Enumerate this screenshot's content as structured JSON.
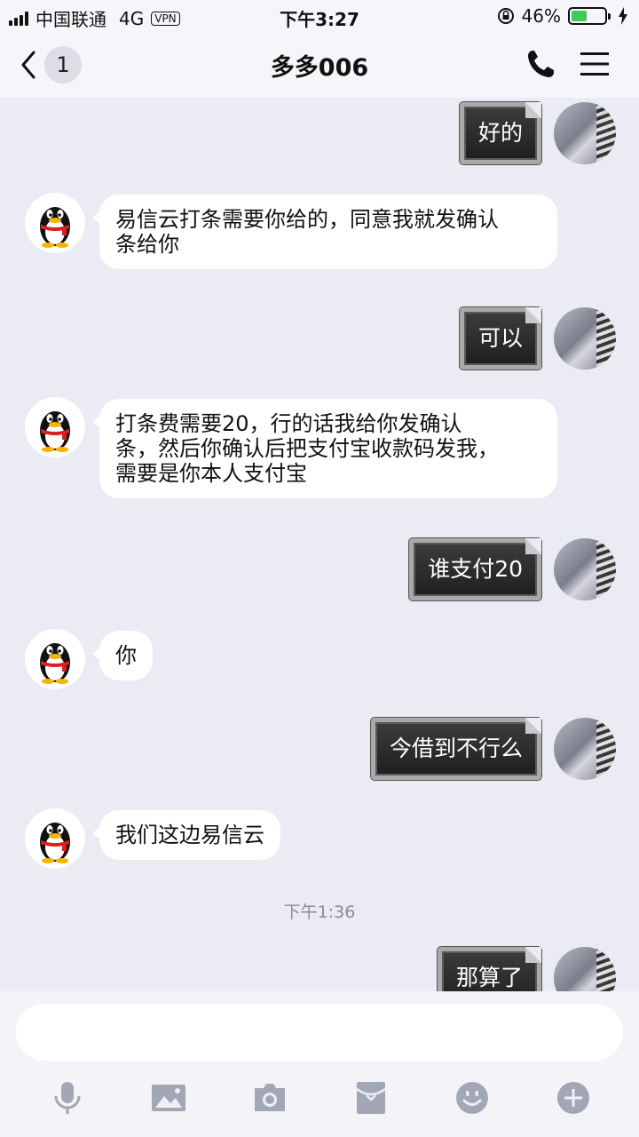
{
  "status_bar": {
    "carrier": "中国联通",
    "network": "4G",
    "vpn": "VPN",
    "time": "下午3:27",
    "battery_percent": "46%",
    "battery_level": 0.46,
    "battery_color": "#3ecb55"
  },
  "nav": {
    "unread_count": "1",
    "title": "多多006"
  },
  "messages": [
    {
      "from": "me",
      "text": "好的"
    },
    {
      "from": "them",
      "lines": [
        "易信云打条需要你给的，同意我就发确认",
        "条给你"
      ]
    },
    {
      "from": "me",
      "text": "可以"
    },
    {
      "from": "them",
      "lines": [
        "打条费需要20，行的话我给你发确认",
        "条，然后你确认后把支付宝收款码发我，",
        "需要是你本人支付宝"
      ]
    },
    {
      "from": "me",
      "text": "谁支付20"
    },
    {
      "from": "them",
      "lines": [
        "你"
      ]
    },
    {
      "from": "me",
      "text": "今借到不行么"
    },
    {
      "from": "them",
      "lines": [
        "我们这边易信云"
      ]
    },
    {
      "type": "time",
      "text": "下午1:36"
    },
    {
      "from": "me",
      "text": "那算了"
    }
  ],
  "input": {
    "value": "",
    "placeholder": ""
  },
  "toolbar": {
    "icons": [
      "microphone-icon",
      "image-icon",
      "camera-icon",
      "red-packet-icon",
      "emoji-icon",
      "plus-icon"
    ]
  },
  "colors": {
    "background": "#eaebf3",
    "bubble_in": "#ffffff",
    "bubble_out": "#2a2a2a",
    "icon_gray": "#a3a6b4"
  }
}
